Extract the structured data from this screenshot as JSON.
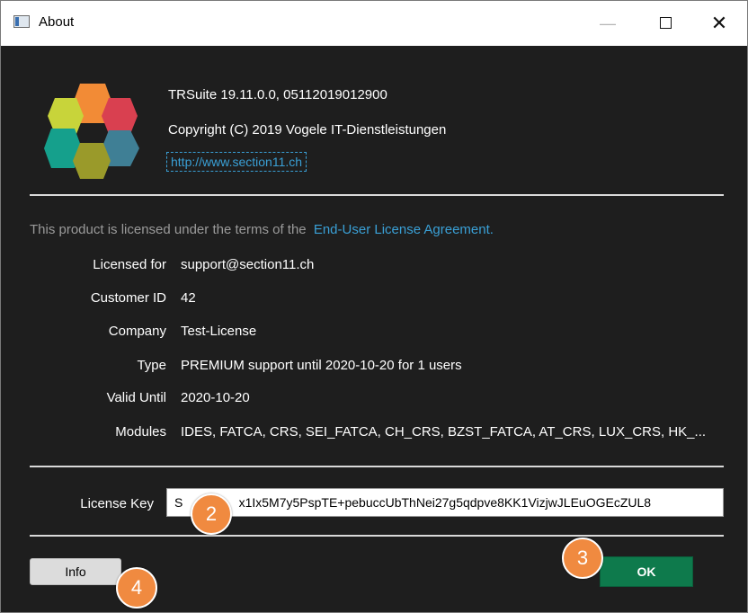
{
  "window": {
    "title": "About"
  },
  "about": {
    "product_line": "TRSuite 19.11.0.0, 05112019012900",
    "copyright": "Copyright (C) 2019 Vogele IT-Dienstleistungen",
    "website": "http://www.section11.ch"
  },
  "license": {
    "terms_text": "This product is licensed under the terms of the",
    "eula_link": "End-User License Agreement.",
    "rows": [
      {
        "label": "Licensed for",
        "value": "support@section11.ch"
      },
      {
        "label": "Customer ID",
        "value": "42"
      },
      {
        "label": "Company",
        "value": "Test-License"
      },
      {
        "label": "Type",
        "value": "PREMIUM support until 2020-10-20 for 1 users"
      },
      {
        "label": "Valid Until",
        "value": "2020-10-20"
      },
      {
        "label": "Modules",
        "value": "IDES, FATCA, CRS, SEI_FATCA, CH_CRS, BZST_FATCA, AT_CRS, LUX_CRS, HK_..."
      }
    ],
    "key_label": "License Key",
    "key_value": "S                x1Ix5M7y5PspTE+pebuccUbThNei27g5qdpve8KK1VizjwJLEuOGEcZUL8"
  },
  "buttons": {
    "info": "Info",
    "ok": "OK"
  },
  "badges": {
    "b2": "2",
    "b3": "3",
    "b4": "4"
  },
  "colors": {
    "accent_link": "#3aa0d6",
    "ok_button": "#0e7a4c",
    "badge": "#f08a40",
    "background": "#1e1e1e"
  },
  "icons": {
    "logo": "hexagon-flower-logo",
    "app": "window-app-icon"
  }
}
